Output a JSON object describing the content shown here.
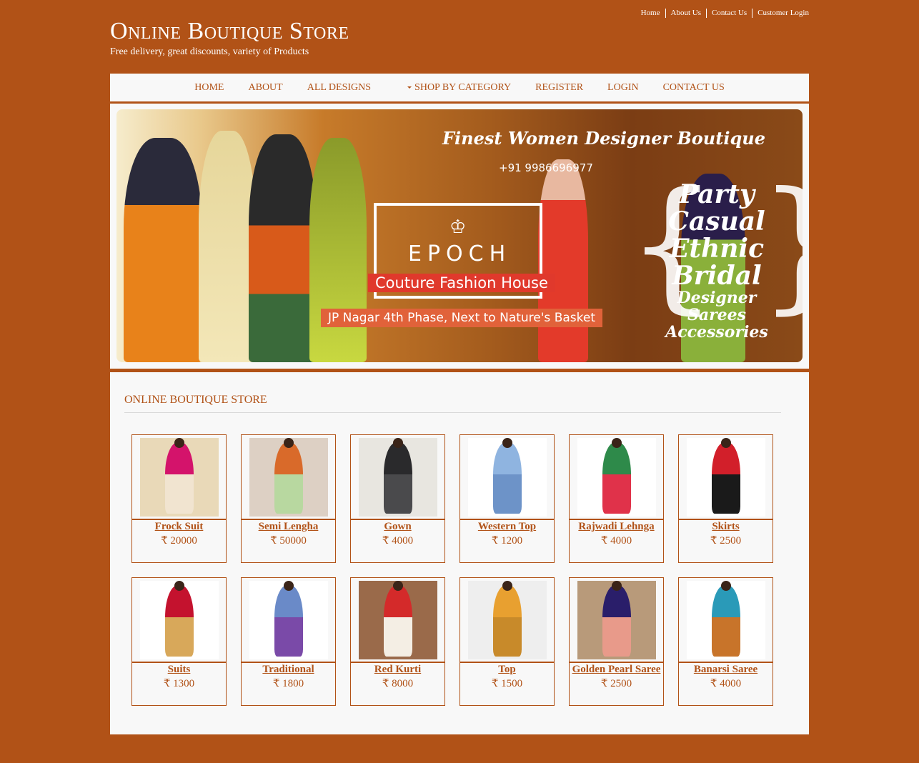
{
  "top_links": [
    "Home",
    "About Us",
    "Contact Us",
    "Customer Login"
  ],
  "site": {
    "title": "Online Boutique Store",
    "tagline": "Free delivery, great discounts, variety of Products"
  },
  "nav": {
    "items": [
      "HOME",
      "ABOUT",
      "ALL DESIGNS",
      "SHOP BY CATEGORY",
      "REGISTER",
      "LOGIN",
      "CONTACT US"
    ]
  },
  "banner": {
    "headline": "Finest Women Designer Boutique",
    "phone": "+91 9986696977",
    "brand": "EPOCH",
    "brand_sub": "Couture Fashion House",
    "address": "JP Nagar 4th Phase, Next to Nature's Basket",
    "categories_big": [
      "Party",
      "Casual",
      "Ethnic",
      "Bridal"
    ],
    "categories_small": [
      "Designer Sarees",
      "Accessories"
    ]
  },
  "section": {
    "title": "ONLINE BOUTIQUE STORE"
  },
  "currency": "₹",
  "products": [
    {
      "name": "Frock Suit",
      "price": "₹ 20000",
      "colors": [
        "#e9d9b8",
        "#d4136b",
        "#f1e4d0"
      ]
    },
    {
      "name": "Semi Lengha",
      "price": "₹ 50000",
      "colors": [
        "#ddd0c4",
        "#d96a2a",
        "#b8d8a0"
      ]
    },
    {
      "name": "Gown",
      "price": "₹ 4000",
      "colors": [
        "#e8e6e0",
        "#2a2a2c",
        "#4a4a4c"
      ]
    },
    {
      "name": "Western Top",
      "price": "₹ 1200",
      "colors": [
        "#ffffff",
        "#8fb4e0",
        "#6d93c8"
      ]
    },
    {
      "name": "Rajwadi Lehnga",
      "price": "₹ 4000",
      "colors": [
        "#ffffff",
        "#2e8a4a",
        "#e0324a"
      ]
    },
    {
      "name": "Skirts",
      "price": "₹ 2500",
      "colors": [
        "#ffffff",
        "#d21f2a",
        "#1a1a1a"
      ]
    },
    {
      "name": "Suits",
      "price": "₹ 1300",
      "colors": [
        "#ffffff",
        "#c4122e",
        "#d8a85a"
      ]
    },
    {
      "name": "Traditional",
      "price": "₹ 1800",
      "colors": [
        "#ffffff",
        "#6a8ac8",
        "#7a4aa8"
      ]
    },
    {
      "name": "Red Kurti",
      "price": "₹ 8000",
      "colors": [
        "#9a6a4a",
        "#d42a2a",
        "#f4eee4"
      ]
    },
    {
      "name": "Top",
      "price": "₹ 1500",
      "colors": [
        "#eeeeee",
        "#e8a030",
        "#c88a2a"
      ]
    },
    {
      "name": "Golden Pearl Saree",
      "price": "₹ 2500",
      "colors": [
        "#b89a7a",
        "#2a1e6a",
        "#e89a8a"
      ]
    },
    {
      "name": "Banarsi Saree",
      "price": "₹ 4000",
      "colors": [
        "#ffffff",
        "#2a9ab8",
        "#c8742a"
      ]
    }
  ]
}
